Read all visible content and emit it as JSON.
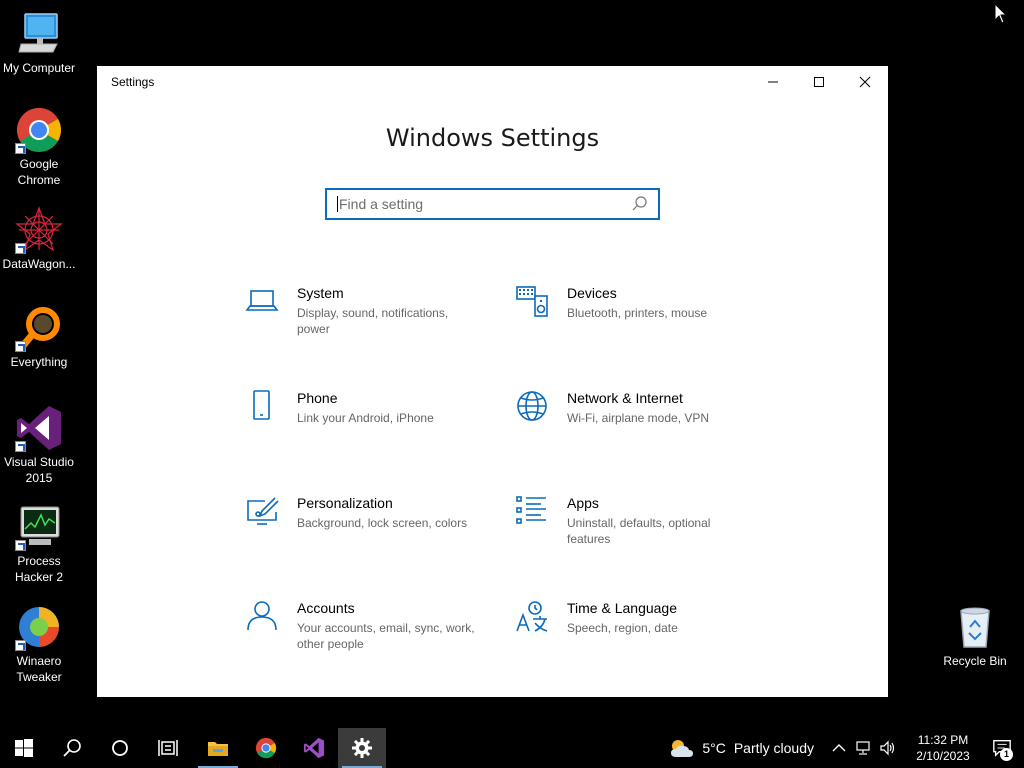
{
  "desktop": {
    "icons": [
      {
        "label": "My Computer",
        "icon": "computer-icon"
      },
      {
        "label": "Google\nChrome",
        "icon": "chrome-icon"
      },
      {
        "label": "DataWagon...",
        "icon": "datawagon-icon"
      },
      {
        "label": "Everything",
        "icon": "everything-icon"
      },
      {
        "label": "Visual Studio\n2015",
        "icon": "visual-studio-icon"
      },
      {
        "label": "Process\nHacker 2",
        "icon": "process-hacker-icon"
      },
      {
        "label": "Winaero\nTweaker",
        "icon": "winaero-icon"
      },
      {
        "label": "Recycle Bin",
        "icon": "recycle-bin-icon"
      }
    ]
  },
  "window": {
    "title": "Settings",
    "heading": "Windows Settings",
    "search_placeholder": "Find a setting",
    "controls": [
      "minimize",
      "maximize",
      "close"
    ]
  },
  "tiles": [
    {
      "name": "System",
      "desc": "Display, sound, notifications, power",
      "icon": "laptop-icon"
    },
    {
      "name": "Devices",
      "desc": "Bluetooth, printers, mouse",
      "icon": "devices-icon"
    },
    {
      "name": "Phone",
      "desc": "Link your Android, iPhone",
      "icon": "phone-icon"
    },
    {
      "name": "Network & Internet",
      "desc": "Wi-Fi, airplane mode, VPN",
      "icon": "globe-icon"
    },
    {
      "name": "Personalization",
      "desc": "Background, lock screen, colors",
      "icon": "paint-icon"
    },
    {
      "name": "Apps",
      "desc": "Uninstall, defaults, optional features",
      "icon": "apps-list-icon"
    },
    {
      "name": "Accounts",
      "desc": "Your accounts, email, sync, work, other people",
      "icon": "person-icon"
    },
    {
      "name": "Time & Language",
      "desc": "Speech, region, date",
      "icon": "time-language-icon"
    }
  ],
  "taskbar": {
    "weather_temp": "5°C",
    "weather_text": "Partly cloudy",
    "time": "11:32 PM",
    "date": "2/10/2023",
    "notification_count": "1"
  },
  "colors": {
    "accent": "#0a6bbd",
    "desktop": "#000000",
    "taskbar_active": "#3b3b3b"
  }
}
